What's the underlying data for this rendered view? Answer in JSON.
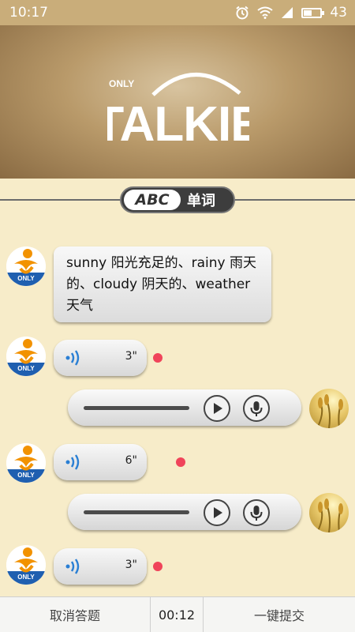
{
  "status_bar": {
    "time": "10:17",
    "battery": "43",
    "battery_level": 0.43
  },
  "banner": {
    "logo_small": "ONLY",
    "logo_main": "TALKIE"
  },
  "section": {
    "badge": "ABC",
    "title": "单词"
  },
  "avatar_brand": {
    "text": "ONLY"
  },
  "messages": {
    "text": "sunny 阳光充足的、rainy 雨天的、cloudy 阴天的、weather 天气",
    "voice1": {
      "duration": "3\""
    },
    "voice2": {
      "duration": "6\""
    },
    "voice3": {
      "duration": "3\""
    }
  },
  "footer": {
    "cancel_label": "取消答题",
    "timer": "00:12",
    "submit_label": "一键提交"
  },
  "icons": [
    "alarm-icon",
    "wifi-icon",
    "signal-icon",
    "battery-icon",
    "voice-icon",
    "play-icon",
    "mic-icon"
  ],
  "colors": {
    "unread": "#f0445a",
    "voice_blue": "#2a7fd4",
    "banner": "#b99a6a",
    "background": "#f7ecc9"
  }
}
